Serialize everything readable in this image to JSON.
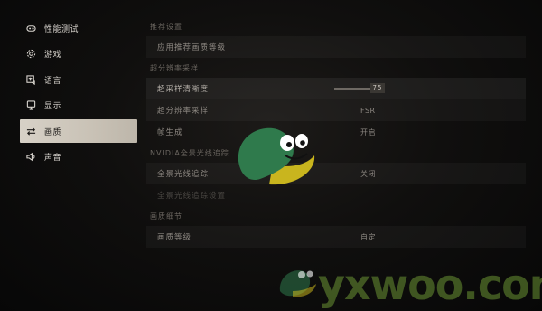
{
  "sidebar": {
    "items": [
      {
        "label": "性能测试",
        "icon": "gamepad-icon"
      },
      {
        "label": "游戏",
        "icon": "gear-icon"
      },
      {
        "label": "语言",
        "icon": "translate-icon"
      },
      {
        "label": "显示",
        "icon": "monitor-icon"
      },
      {
        "label": "画质",
        "icon": "swap-arrows-icon",
        "active": true
      },
      {
        "label": "声音",
        "icon": "speaker-icon"
      }
    ]
  },
  "main": {
    "sections": [
      {
        "title": "推荐设置",
        "rows": [
          {
            "label": "应用推荐画质等级",
            "value": ""
          }
        ]
      },
      {
        "title": "超分辨率采样",
        "rows": [
          {
            "label": "超采样清晰度",
            "value": "75",
            "type": "slider",
            "slider_fraction": 0.75
          },
          {
            "label": "超分辨率采样",
            "value": "FSR"
          },
          {
            "label": "帧生成",
            "value": "开启"
          }
        ]
      },
      {
        "title": "NVIDIA全景光线追踪",
        "rows": [
          {
            "label": "全景光线追踪",
            "value": "关闭"
          },
          {
            "label": "全景光线追踪设置",
            "value": "",
            "dim": true
          }
        ]
      },
      {
        "title": "画质细节",
        "rows": [
          {
            "label": "画质等级",
            "value": "自定"
          }
        ]
      }
    ]
  },
  "watermark": {
    "text": "yxwoo.com",
    "colors": {
      "green": "#2f7a4c",
      "yellow": "#d8c21e",
      "text": "#96d246"
    }
  }
}
